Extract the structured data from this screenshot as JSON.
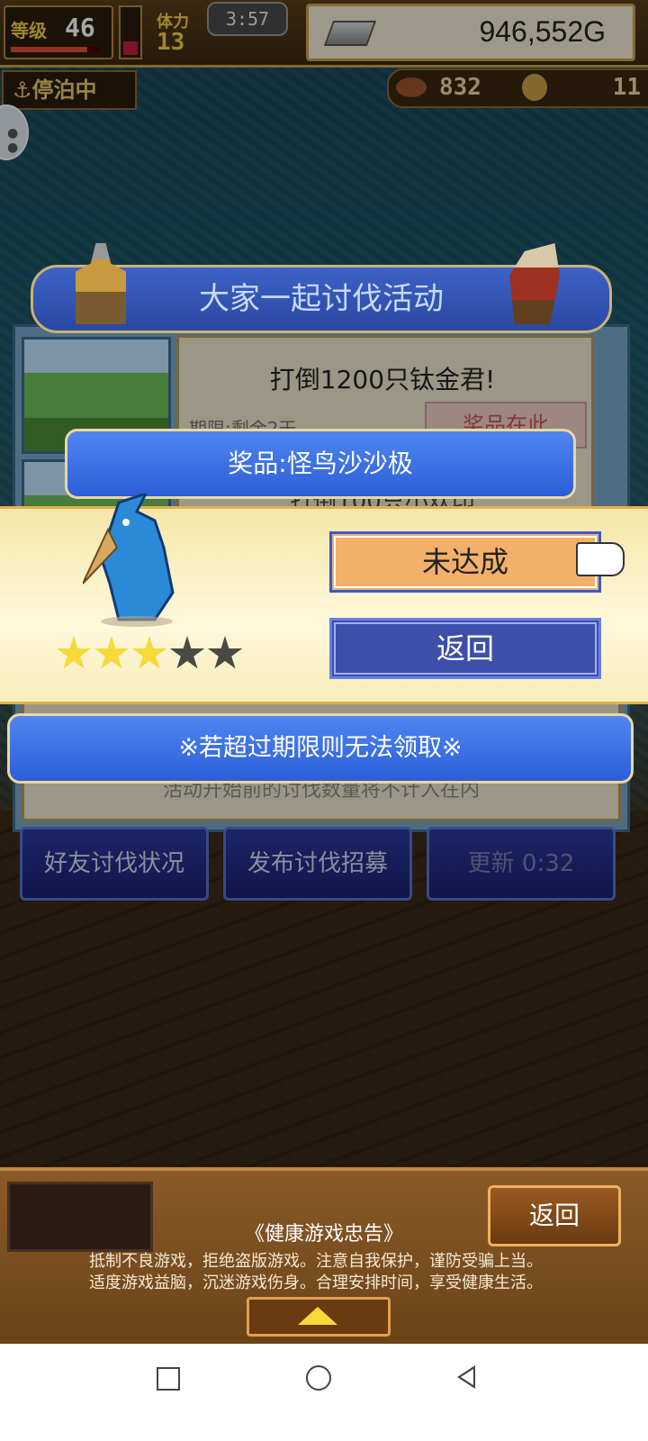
{
  "hud": {
    "level_label": "等级",
    "level_value": "46",
    "level_progress": 0.85,
    "stamina_level": 0.3,
    "crew_label": "体力",
    "crew_value": "13",
    "time": "3:57",
    "gold": "946,552G",
    "dock_status": "⚓停泊中",
    "food": "832",
    "coins": "11"
  },
  "event": {
    "title": "大家一起讨伐活动",
    "goal": "打倒1200只钛金君!",
    "period": "期限:剩余2天",
    "reward_list_label": "奖品在此",
    "goal_secondary": "打倒100只小欢印",
    "note": "活动开始前的讨伐数量将不计入在内"
  },
  "buttons": {
    "friend_status": "好友讨伐状况",
    "post_recruit": "发布讨伐招募",
    "refresh": "更新 0:32"
  },
  "popup": {
    "prize_title": "奖品:怪鸟沙沙极",
    "status_button": "未达成",
    "back_button": "返回",
    "expiry_notice": "※若超过期限则无法领取※",
    "rating": 3,
    "rating_max": 5
  },
  "footer": {
    "back_button": "返回",
    "health_title": "《健康游戏忠告》",
    "health_line1": "抵制不良游戏，拒绝盗版游戏。注意自我保护，谨防受骗上当。",
    "health_line2": "适度游戏益脑，沉迷游戏伤身。合理安排时间，享受健康生活。"
  },
  "colors": {
    "accent_blue": "#2c5ed8",
    "status_orange": "#f2b06a",
    "star_on": "#f7d93a"
  },
  "icons": [
    "anchor-icon",
    "meat-icon",
    "coin-icon",
    "silver-bar-icon",
    "chat-icon",
    "pointing-hand-icon",
    "up-arrow-icon"
  ]
}
